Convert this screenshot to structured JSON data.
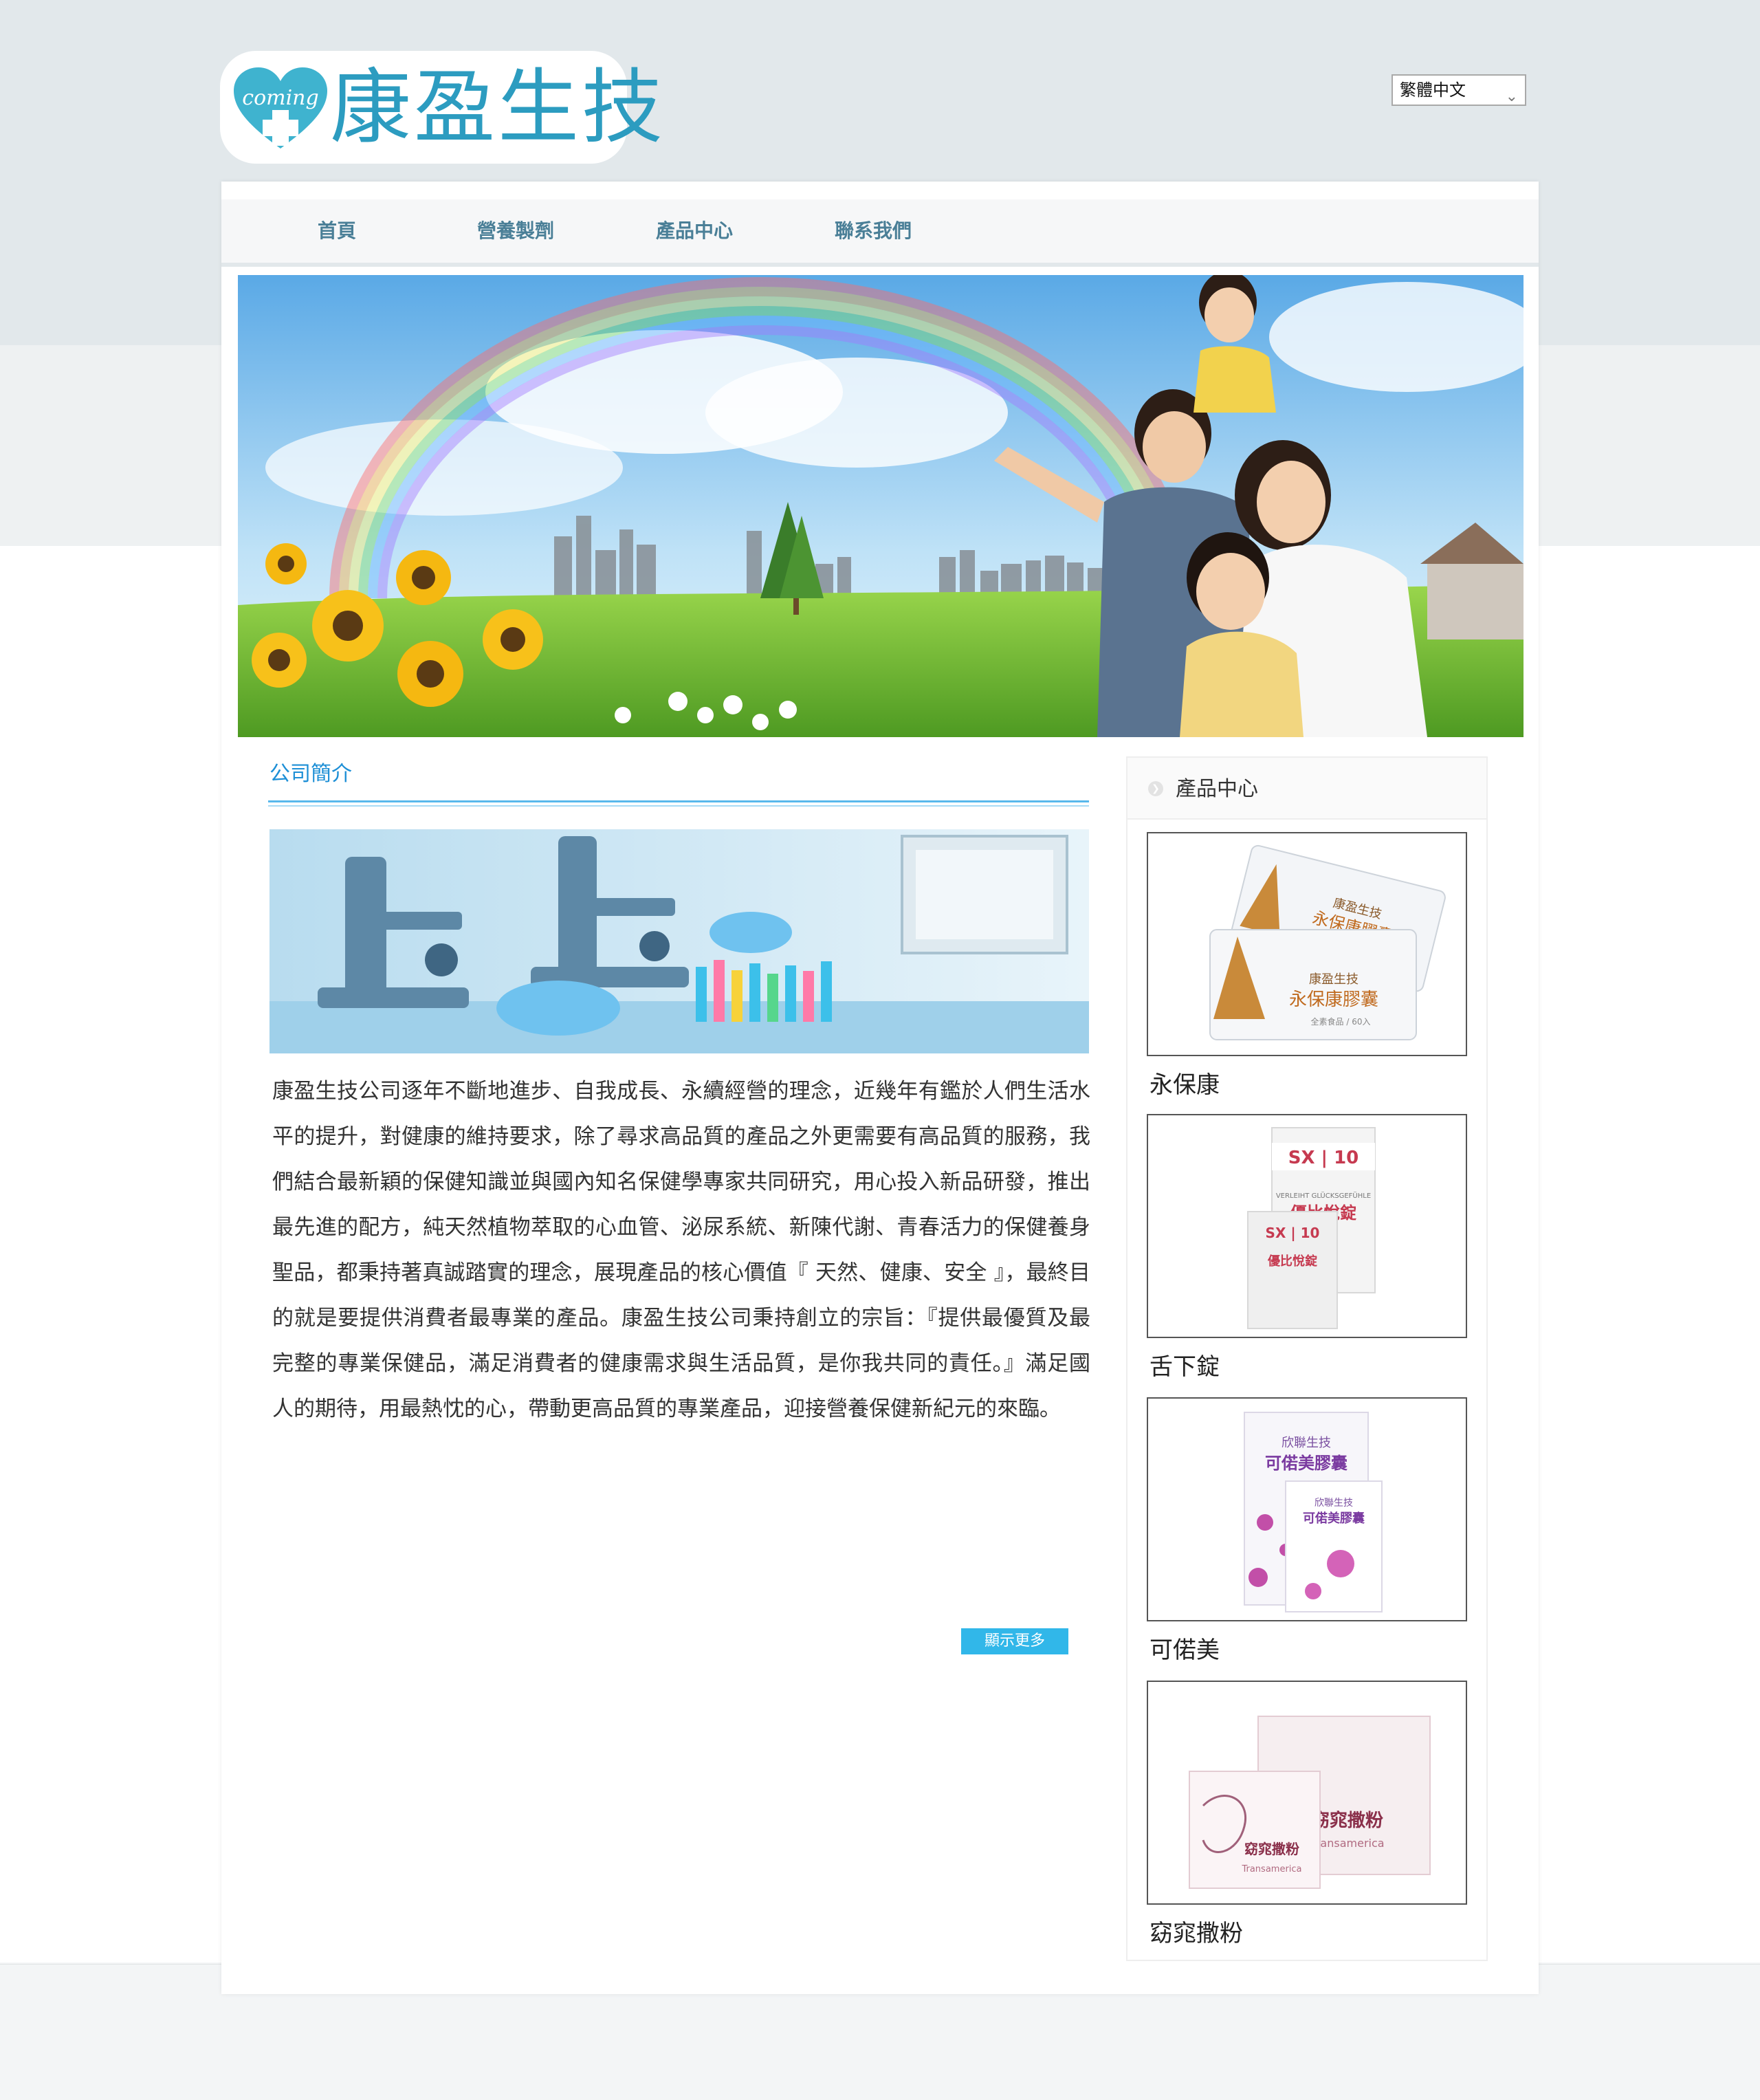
{
  "header": {
    "logo_text": "康盈生技",
    "logo_badge": "coming",
    "language": "繁體中文"
  },
  "nav": {
    "items": [
      {
        "label": "首頁"
      },
      {
        "label": "營養製劑"
      },
      {
        "label": "產品中心"
      },
      {
        "label": "聯系我們"
      }
    ]
  },
  "about": {
    "title": "公司簡介",
    "body": "康盈生技公司逐年不斷地進步、自我成長、永續經營的理念，近幾年有鑑於人們生活水平的提升，對健康的維持要求，除了尋求高品質的產品之外更需要有高品質的服務，我們結合最新穎的保健知識並與國內知名保健學專家共同研究，用心投入新品研發，推出最先進的配方，純天然植物萃取的心血管、泌尿系統、新陳代謝、青春活力的保健養身聖品，都秉持著真誠踏實的理念，展現產品的核心價值『 天然、健康、安全 』，最終目的就是要提供消費者最專業的產品。康盈生技公司秉持創立的宗旨：『提供最優質及最完整的專業保健品，滿足消費者的健康需求與生活品質，是你我共同的責任。』滿足國人的期待，用最熱忱的心，帶動更高品質的專業產品，迎接營養保健新紀元的來臨。",
    "more_label": "顯示更多"
  },
  "products": {
    "title": "產品中心",
    "items": [
      {
        "name": "永保康",
        "box_brand": "康盈生技",
        "box_title": "永保康膠囊",
        "box_sub": "全素食品 / 60入"
      },
      {
        "name": "舌下錠",
        "box_brand": "SX | 10",
        "box_title": "優比悅錠",
        "box_sub": "VERLEIHT GLÜCKSGEFÜHLE"
      },
      {
        "name": "可偌美",
        "box_brand": "欣聯生技",
        "box_title": "可偌美膠囊",
        "box_sub": ""
      },
      {
        "name": "窈窕撒粉",
        "box_brand": "Transamerica",
        "box_title": "窈窕撒粉",
        "box_sub": ""
      }
    ]
  },
  "colors": {
    "accent": "#2c9cc0",
    "nav_text": "#4a7f97",
    "title_blue": "#1d8fd6",
    "button": "#31b7e9"
  }
}
